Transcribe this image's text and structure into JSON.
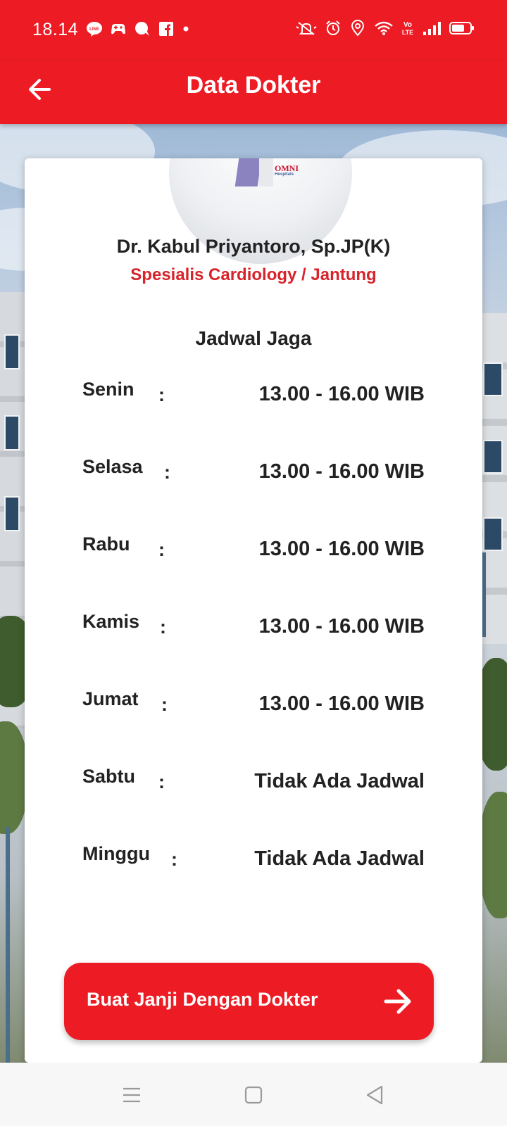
{
  "status_bar": {
    "time": "18.14",
    "left_icons": [
      "line-icon",
      "game-controller-icon",
      "chat-bubble-icon",
      "facebook-icon",
      "dot-icon"
    ],
    "right_icons": [
      "mute-icon",
      "alarm-icon",
      "location-icon",
      "wifi-icon",
      "volte-icon",
      "signal-icon",
      "battery-icon"
    ]
  },
  "app_bar": {
    "title": "Data Dokter",
    "back_icon": "arrow-left-icon"
  },
  "doctor": {
    "name": "Dr. Kabul Priyantoro, Sp.JP(K)",
    "specialty": "Spesialis Cardiology / Jantung",
    "photo_logo": "OMNI",
    "photo_logo_sub": "Hospitals"
  },
  "schedule": {
    "title": "Jadwal Jaga",
    "separator": ":",
    "rows": [
      {
        "day": "Senin",
        "time": "13.00 - 16.00 WIB"
      },
      {
        "day": "Selasa",
        "time": "13.00 - 16.00 WIB"
      },
      {
        "day": "Rabu",
        "time": "13.00 - 16.00 WIB"
      },
      {
        "day": "Kamis",
        "time": "13.00 - 16.00 WIB"
      },
      {
        "day": "Jumat",
        "time": "13.00 - 16.00 WIB"
      },
      {
        "day": "Sabtu",
        "time": "Tidak Ada Jadwal"
      },
      {
        "day": "Minggu",
        "time": "Tidak Ada Jadwal"
      }
    ]
  },
  "cta": {
    "label": "Buat Janji Dengan Dokter",
    "icon": "arrow-right-icon"
  },
  "nav_bar": {
    "buttons": [
      "menu-icon",
      "home-square-icon",
      "back-triangle-icon"
    ]
  },
  "colors": {
    "brand_red": "#ed1c24",
    "specialty_red": "#d8232a",
    "text_dark": "#222222"
  }
}
